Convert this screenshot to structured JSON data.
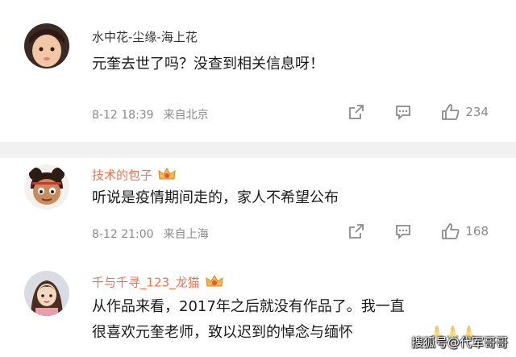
{
  "comments": [
    {
      "username": "水中花-尘缘-海上花",
      "text_lines": [
        "元奎去世了吗？没查到相关信息呀！"
      ],
      "date": "8-12 18:39",
      "source": "来自北京",
      "likes": "234"
    },
    {
      "username": "技术的包子",
      "text_lines": [
        "听说是疫情期间走的，家人不希望公布"
      ],
      "date": "8-12 21:00",
      "source": "来自上海",
      "likes": "168"
    },
    {
      "username": "千与千寻_123_龙猫",
      "text_lines": [
        "从作品来看，2017年之后就没有作品了。我一直",
        "很喜欢元奎老师，致以迟到的悼念与缅怀"
      ]
    }
  ],
  "icons": {
    "share": "share-icon",
    "comment": "comment-icon",
    "like": "thumbs-up-icon",
    "vip_badge": "vip-crown-badge-icon",
    "praying_hands": "praying-hands-emoji"
  },
  "colors": {
    "vip_name": "#eb7350",
    "plain_name": "#333333",
    "meta": "#8a8a8a",
    "separator": "#f1f1f1"
  },
  "watermark": "搜狐号@代军哥哥"
}
